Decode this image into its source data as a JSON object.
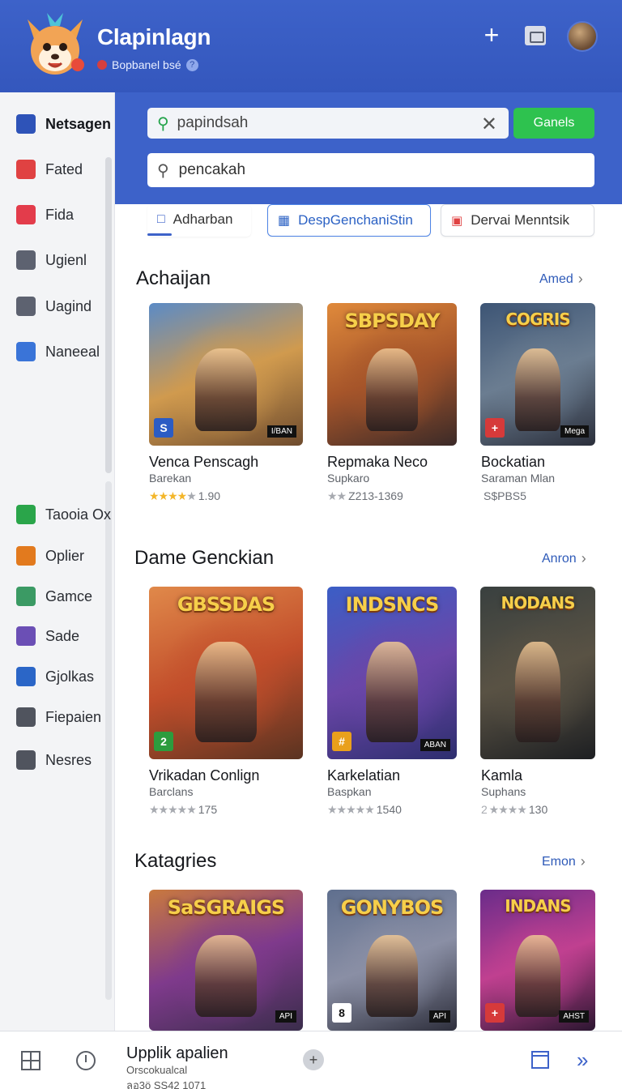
{
  "header": {
    "title": "Clapinlagn",
    "subtitle": "Bopbanel bsé",
    "plus_label": "+"
  },
  "search": {
    "query_value": "papindsah",
    "button_label": "Ganels",
    "second_value": "pencakah"
  },
  "chips": [
    {
      "label": "Adharban"
    },
    {
      "label": "DespGenchaniStin"
    },
    {
      "label": "Dervai Menntsik"
    }
  ],
  "sidebar": {
    "items": [
      {
        "label": "Netsagen",
        "icon": "users-icon",
        "color": "#2e53b8"
      },
      {
        "label": "Fated",
        "icon": "star-icon",
        "color": "#e04242"
      },
      {
        "label": "Fida",
        "icon": "folder-icon",
        "color": "#e33c4b"
      },
      {
        "label": "Ugienl",
        "icon": "document-icon",
        "color": "#5d6270"
      },
      {
        "label": "Uagind",
        "icon": "image-icon",
        "color": "#5d6270"
      },
      {
        "label": "Naneeal",
        "icon": "edit-icon",
        "color": "#3a74d8"
      },
      {
        "label": "Taooia Ox",
        "icon": "person-icon",
        "color": "#2aa54a"
      },
      {
        "label": "Oplier",
        "icon": "target-icon",
        "color": "#e27a1e"
      },
      {
        "label": "Gamce",
        "icon": "people-icon",
        "color": "#3b9a64"
      },
      {
        "label": "Sade",
        "icon": "circle-icon",
        "color": "#6b4fb5"
      },
      {
        "label": "Gjolkas",
        "icon": "globe-icon",
        "color": "#2b66c7"
      },
      {
        "label": "Fiepaien",
        "icon": "clipboard-icon",
        "color": "#50545e"
      },
      {
        "label": "Nesres",
        "icon": "crown-icon",
        "color": "#50545e"
      }
    ]
  },
  "sections": [
    {
      "title": "Achaijan",
      "more": "Amed",
      "cards": [
        {
          "title": "Venca Penscagh",
          "sub": "Barekan",
          "stars": "★★★★",
          "grey_stars": "★",
          "rating": "1.90",
          "banner": "",
          "badge": "S",
          "tag": "I/BAN",
          "colors": [
            "#5b8bc6",
            "#d09a4e",
            "#6e4b2e"
          ]
        },
        {
          "title": "Repmaka Neco",
          "sub": "Supkaro",
          "stars": "",
          "grey_stars": "★★",
          "rating": "Z213-1369",
          "banner": "SBPSDAY",
          "badge": "",
          "tag": "",
          "colors": [
            "#e08a3b",
            "#a6552a",
            "#3b2a28"
          ]
        },
        {
          "title": "Bockatian",
          "sub": "Saraman Mlan",
          "stars": "",
          "grey_stars": "",
          "rating": "S$PBS5",
          "banner": "COGRIS",
          "badge": "+",
          "tag": "Mega",
          "colors": [
            "#3d5575",
            "#6b7d91",
            "#2b2f3b"
          ]
        }
      ]
    },
    {
      "title": "Dame Genckian",
      "more": "Anron",
      "cards": [
        {
          "title": "Vrikadan Conlign",
          "sub": "Barclans",
          "stars": "",
          "grey_stars": "★★★★★",
          "rating": "175",
          "banner": "GBSSDAS",
          "badge": "2",
          "tag": "",
          "colors": [
            "#e0894a",
            "#c24e2b",
            "#5a3321"
          ]
        },
        {
          "title": "Karkelatian",
          "sub": "Baspkan",
          "stars": "",
          "grey_stars": "★★★★★",
          "rating": "1540",
          "banner": "INDSNCS",
          "badge": "#",
          "tag": "ABAN",
          "colors": [
            "#3b5ec6",
            "#6a46a8",
            "#2d2e6e"
          ]
        },
        {
          "title": "Kamla",
          "sub": "Suphans",
          "stars": "",
          "grey_stars": "2 ★★★★",
          "rating": "130",
          "banner": "NODANS",
          "badge": "",
          "tag": "",
          "colors": [
            "#39403f",
            "#595244",
            "#1d1f22"
          ]
        }
      ]
    },
    {
      "title": "Katagries",
      "more": "Emon",
      "cards": [
        {
          "title": "",
          "sub": "",
          "stars": "",
          "grey_stars": "",
          "rating": "",
          "banner": "SaSGRAIGS",
          "badge": "",
          "tag": "API",
          "colors": [
            "#c9793e",
            "#7f3a8c",
            "#3a2d4b"
          ]
        },
        {
          "title": "",
          "sub": "",
          "stars": "",
          "grey_stars": "",
          "rating": "",
          "banner": "GONYBOS",
          "badge": "8",
          "tag": "API",
          "colors": [
            "#5f6f8e",
            "#8a8fa5",
            "#2e2f3c"
          ]
        },
        {
          "title": "",
          "sub": "",
          "stars": "",
          "grey_stars": "",
          "rating": "",
          "banner": "INDANS",
          "badge": "+",
          "tag": "AHST",
          "colors": [
            "#6a2c8a",
            "#c04090",
            "#2b1630"
          ]
        }
      ]
    }
  ],
  "bottom": {
    "title": "Upplik apalien",
    "sub": "Orscokualcal",
    "sub2": "ลอ3ö SS42 1071",
    "plus": "+",
    "double": "»"
  }
}
